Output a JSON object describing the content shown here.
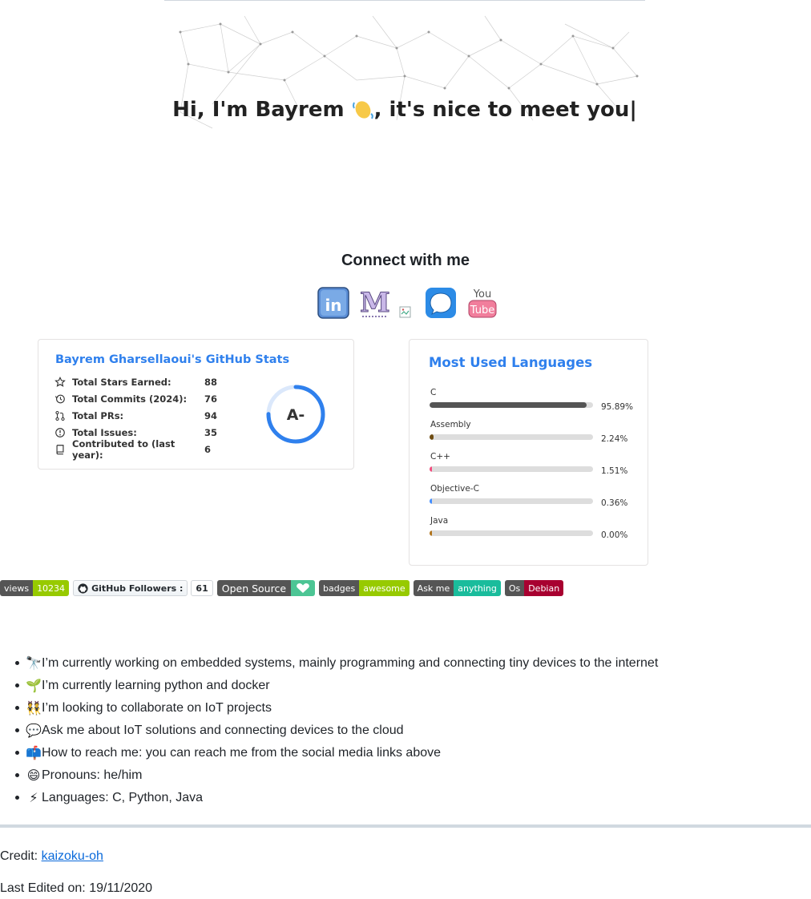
{
  "banner": {
    "greeting": "Hi, I'm Bayrem",
    "rest": ", it's nice to meet you|"
  },
  "connect": {
    "title": "Connect with me",
    "links": [
      {
        "name": "linkedin-icon",
        "label": "in"
      },
      {
        "name": "medium-icon",
        "label": "M"
      },
      {
        "name": "broken-image-icon",
        "label": ""
      },
      {
        "name": "signal-icon",
        "label": ""
      },
      {
        "name": "youtube-icon",
        "label_top": "You",
        "label_bottom": "Tube"
      }
    ]
  },
  "stats": {
    "title": "Bayrem Gharsellaoui's GitHub Stats",
    "rows": [
      {
        "label": "Total Stars Earned:",
        "value": "88",
        "icon": "star-icon"
      },
      {
        "label": "Total Commits (2024):",
        "value": "76",
        "icon": "history-icon"
      },
      {
        "label": "Total PRs:",
        "value": "94",
        "icon": "pull-request-icon"
      },
      {
        "label": "Total Issues:",
        "value": "35",
        "icon": "issue-icon"
      },
      {
        "label": "Contributed to (last year):",
        "value": "6",
        "icon": "repo-icon"
      }
    ],
    "rank": "A-",
    "rank_progress": 0.75,
    "colors": {
      "title": "#2f80ed",
      "ring": "#2f80ed"
    }
  },
  "languages": {
    "title": "Most Used Languages",
    "items": [
      {
        "name": "C",
        "percent": "95.89%",
        "value": 95.89,
        "color": "#555555"
      },
      {
        "name": "Assembly",
        "percent": "2.24%",
        "value": 2.24,
        "color": "#6E4C13"
      },
      {
        "name": "C++",
        "percent": "1.51%",
        "value": 1.51,
        "color": "#f34b7d"
      },
      {
        "name": "Objective-C",
        "percent": "0.36%",
        "value": 0.36,
        "color": "#438eff"
      },
      {
        "name": "Java",
        "percent": "0.00%",
        "value": 0.0,
        "color": "#b07219"
      }
    ]
  },
  "badges": {
    "views": {
      "label": "views",
      "value": "10234"
    },
    "followers": {
      "label": "GitHub Followers :",
      "value": "61"
    },
    "open_source": {
      "label": "Open Source"
    },
    "awesome": {
      "label": "badges",
      "value": "awesome"
    },
    "ask": {
      "label": "Ask me",
      "value": "anything"
    },
    "os": {
      "label": "Os",
      "value": "Debian"
    }
  },
  "about": [
    {
      "emoji": "🔭",
      "text": "I’m currently working on embedded systems, mainly programming and connecting tiny devices to the internet"
    },
    {
      "emoji": "🌱",
      "text": "I’m currently learning python and docker"
    },
    {
      "emoji": "👯",
      "text": "I’m looking to collaborate on IoT projects"
    },
    {
      "emoji": "💬",
      "text": "Ask me about IoT solutions and connecting devices to the cloud"
    },
    {
      "emoji": "📫",
      "text": "How to reach me: you can reach me from the social media links above"
    },
    {
      "emoji": "😄",
      "text": "Pronouns: he/him"
    },
    {
      "emoji": "⚡",
      "text": "Languages: C, Python, Java"
    }
  ],
  "footer": {
    "credit_label": "Credit: ",
    "credit_link": "kaizoku-oh",
    "edited": "Last Edited on: 19/11/2020"
  }
}
